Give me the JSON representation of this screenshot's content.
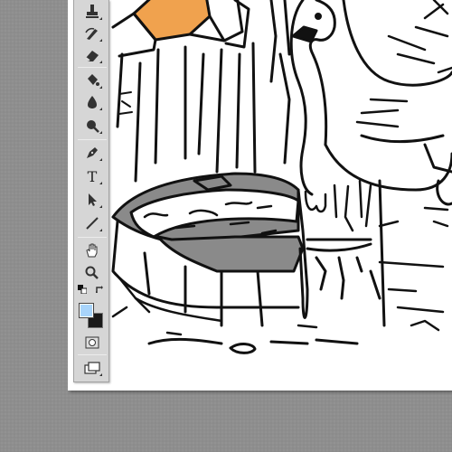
{
  "app": {
    "name": "image-editor"
  },
  "colors": {
    "workspace": "#8e8e8e",
    "toolbar": "#d6d6d6",
    "foreground_swatch": "#a8d4fa",
    "background_swatch": "#1a1a1a",
    "highlight_fill": "#f0a24e",
    "selected_fill": "#8a8a8a"
  },
  "toolbar": {
    "tools": [
      {
        "name": "stamp-tool-icon"
      },
      {
        "name": "history-brush-tool-icon"
      },
      {
        "name": "eraser-tool-icon"
      },
      {
        "name": "paint-bucket-tool-icon"
      },
      {
        "name": "blur-tool-icon"
      },
      {
        "name": "dodge-tool-icon"
      },
      {
        "name": "pen-tool-icon"
      },
      {
        "name": "type-tool-icon",
        "glyph": "T"
      },
      {
        "name": "path-selection-tool-icon"
      },
      {
        "name": "line-tool-icon"
      },
      {
        "name": "hand-tool-icon"
      },
      {
        "name": "zoom-tool-icon"
      },
      {
        "name": "default-colors-icon"
      },
      {
        "name": "swap-colors-icon"
      },
      {
        "name": "quick-mask-icon"
      },
      {
        "name": "screen-mode-icon"
      }
    ]
  },
  "canvas": {
    "content": "coloring-page-swan-fountain"
  }
}
